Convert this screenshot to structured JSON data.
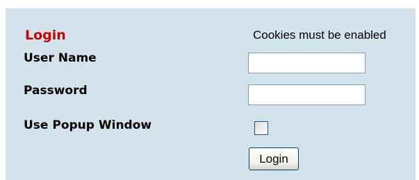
{
  "login_form": {
    "title": "Login",
    "notice": "Cookies must be enabled",
    "username_label": "User Name",
    "username_value": "",
    "password_label": "Password",
    "password_value": "",
    "popup_label": "Use Popup Window",
    "popup_checked": false,
    "login_button_label": "Login"
  },
  "colors": {
    "panel_background": "#d3e3ec",
    "title_color": "#cc0000"
  }
}
